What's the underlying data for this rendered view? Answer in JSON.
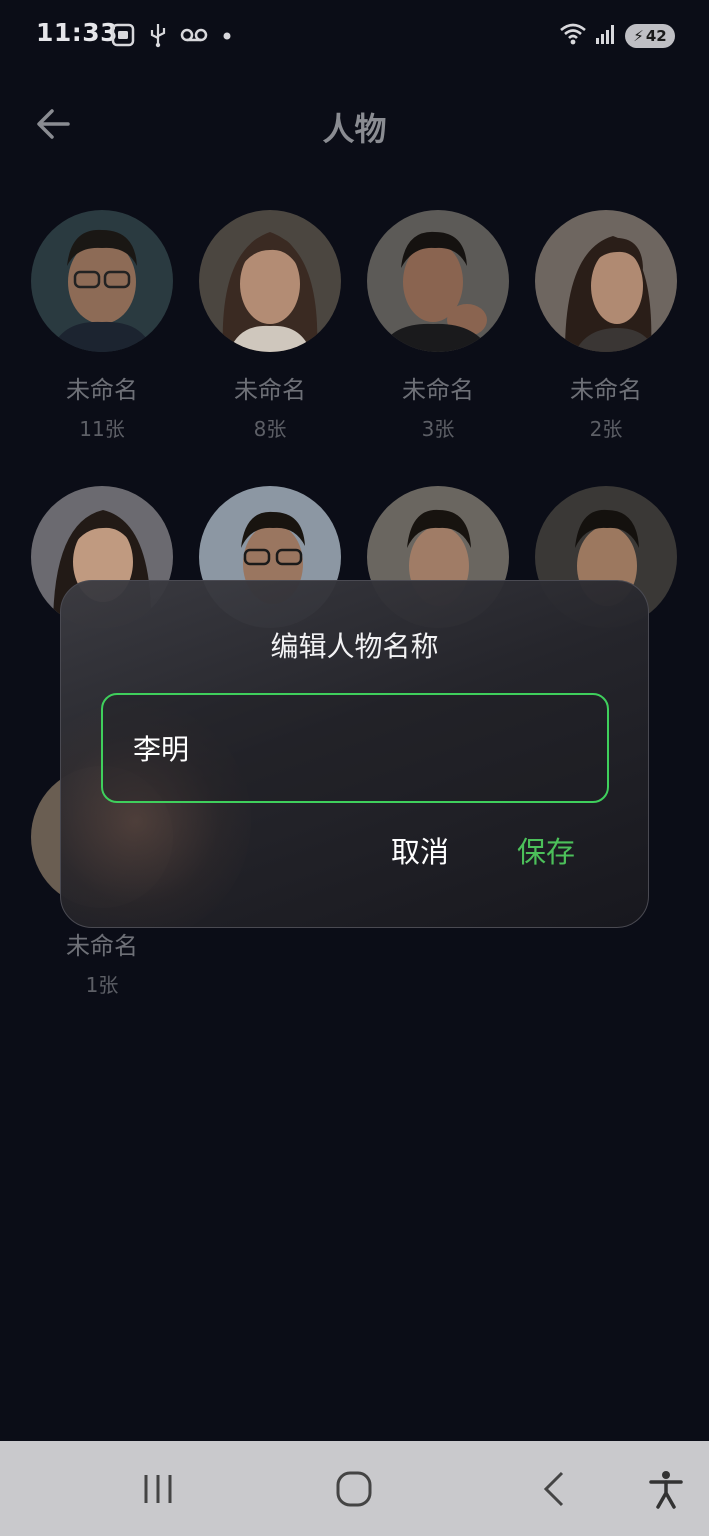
{
  "status_bar": {
    "time": "11:33",
    "battery": "42"
  },
  "header": {
    "title": "人物"
  },
  "people": [
    {
      "name": "未命名",
      "count": "11张"
    },
    {
      "name": "未命名",
      "count": "8张"
    },
    {
      "name": "未命名",
      "count": "3张"
    },
    {
      "name": "未命名",
      "count": "2张"
    },
    {
      "name": "",
      "count": ""
    },
    {
      "name": "",
      "count": ""
    },
    {
      "name": "",
      "count": ""
    },
    {
      "name": "",
      "count": ""
    },
    {
      "name": "未命名",
      "count": "1张"
    }
  ],
  "dialog": {
    "title": "编辑人物名称",
    "input_value": "李明",
    "cancel_label": "取消",
    "save_label": "保存"
  },
  "colors": {
    "accent": "#4cc05a",
    "background": "#0b0d17"
  }
}
